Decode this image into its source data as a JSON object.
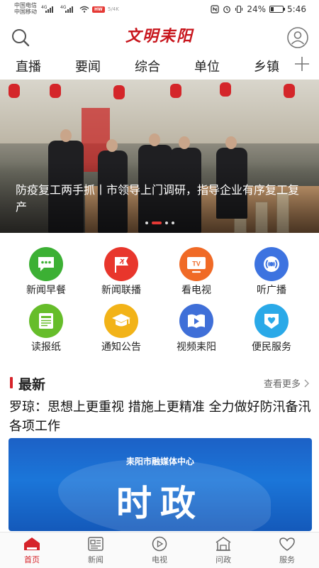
{
  "status_bar": {
    "carrier1": "中国电信",
    "carrier2": "中国移动",
    "network1": "4G",
    "network2": "4G",
    "badge": "HW",
    "extra": "5/4K",
    "battery_percent": "24%",
    "battery_level": 0.24,
    "time": "5:46"
  },
  "header": {
    "logo_text": "文明耒阳"
  },
  "nav": {
    "tabs": [
      "直播",
      "要闻",
      "综合",
      "单位",
      "乡镇"
    ]
  },
  "banner": {
    "caption": "防疫复工两手抓丨市领导上门调研，指导企业有序复工复产",
    "slide_count": 4,
    "active_slide": 1
  },
  "grid": [
    {
      "label": "新闻早餐",
      "icon": "chat-bubble-icon",
      "color": "#3cb034"
    },
    {
      "label": "新闻联播",
      "icon": "party-flag-icon",
      "color": "#e8362c"
    },
    {
      "label": "看电视",
      "icon": "tv-icon",
      "color": "#f06a26"
    },
    {
      "label": "听广播",
      "icon": "radio-icon",
      "color": "#3d73e0"
    },
    {
      "label": "读报纸",
      "icon": "newspaper-icon",
      "color": "#66bd2a"
    },
    {
      "label": "通知公告",
      "icon": "graduation-cap-icon",
      "color": "#f2b318"
    },
    {
      "label": "视频耒阳",
      "icon": "book-play-icon",
      "color": "#3f6fd8"
    },
    {
      "label": "便民服务",
      "icon": "heart-icon",
      "color": "#2aa9e8"
    }
  ],
  "latest": {
    "title": "最新",
    "more_label": "查看更多",
    "headline": "罗琼：思想上更重视 措施上更精准 全力做好防汛备汛各项工作",
    "image_subtitle": "耒阳市融媒体中心",
    "image_title": "时政"
  },
  "bottom_nav": {
    "items": [
      {
        "label": "首页",
        "icon": "home-icon",
        "active": true
      },
      {
        "label": "新闻",
        "icon": "news-icon",
        "active": false
      },
      {
        "label": "电视",
        "icon": "tv-play-icon",
        "active": false
      },
      {
        "label": "问政",
        "icon": "building-icon",
        "active": false
      },
      {
        "label": "服务",
        "icon": "heart-icon",
        "active": false
      }
    ]
  },
  "colors": {
    "brand_red": "#d6232a",
    "text": "#222222"
  }
}
